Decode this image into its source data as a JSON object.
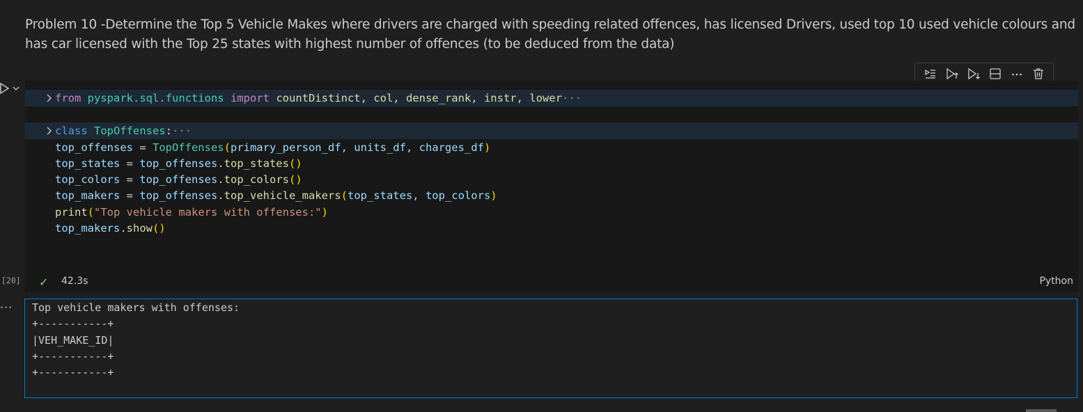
{
  "markdown": {
    "text": "Problem 10 -Determine the Top 5 Vehicle Makes where drivers are charged with speeding related offences, has licensed Drivers, used top 10 used vehicle colours and has car licensed with the Top 25 states with highest number of offences (to be deduced from the data)"
  },
  "toolbar": {
    "icons": [
      "execute-above-icon",
      "run-above-icon",
      "run-below-icon",
      "split-cell-icon",
      "more-icon",
      "delete-icon"
    ]
  },
  "code": {
    "line1": {
      "kw1": "from",
      "module": "pyspark.sql.functions",
      "kw2": "import",
      "names": "countDistinct, col, dense_rank, instr, lower",
      "fold": "···"
    },
    "line2": {
      "kw": "class",
      "name": "TopOffenses",
      "colon": ":",
      "fold": "···"
    },
    "line3": {
      "var": "top_offenses",
      "eq": " = ",
      "cls": "TopOffenses",
      "open": "(",
      "args": "primary_person_df, units_df, charges_df",
      "close": ")"
    },
    "line4": {
      "var": "top_states",
      "eq": " = ",
      "obj": "top_offenses",
      "dot": ".",
      "method": "top_states",
      "parens": "()"
    },
    "line5": {
      "var": "top_colors",
      "eq": " = ",
      "obj": "top_offenses",
      "dot": ".",
      "method": "top_colors",
      "parens": "()"
    },
    "line6": {
      "var": "top_makers",
      "eq": " = ",
      "obj": "top_offenses",
      "dot": ".",
      "method": "top_vehicle_makers",
      "open": "(",
      "args": "top_states, top_colors",
      "close": ")"
    },
    "line7": {
      "fn": "print",
      "open": "(",
      "str": "\"Top vehicle makers with offenses:\"",
      "close": ")"
    },
    "line8": {
      "obj": "top_makers",
      "dot": ".",
      "method": "show",
      "parens": "()"
    }
  },
  "cell_status": {
    "exec_count": "[20]",
    "check": "✓",
    "duration": "42.3s",
    "language": "Python"
  },
  "output": {
    "dots": "···",
    "lines": [
      "Top vehicle makers with offenses:",
      "+-----------+",
      "|VEH_MAKE_ID|",
      "+-----------+",
      "+-----------+"
    ]
  }
}
